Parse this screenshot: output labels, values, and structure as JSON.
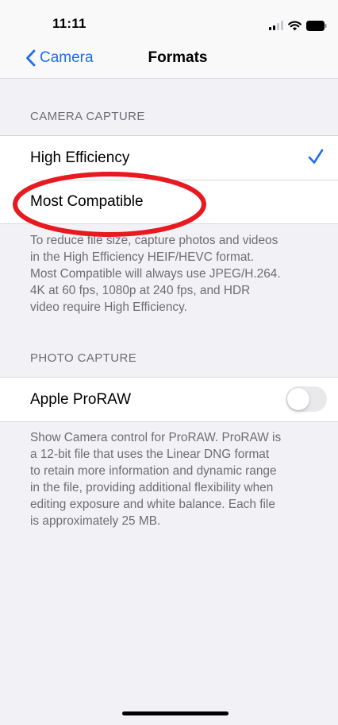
{
  "status_bar": {
    "time": "11:11",
    "icons": [
      "cellular-signal-icon",
      "wifi-icon",
      "battery-icon"
    ]
  },
  "nav": {
    "back_label": "Camera",
    "back_icon": "chevron-left-icon",
    "title": "Formats"
  },
  "camera_capture": {
    "header": "CAMERA CAPTURE",
    "options": [
      {
        "label": "High Efficiency",
        "selected": true
      },
      {
        "label": "Most Compatible",
        "selected": false
      }
    ],
    "footer_lines": [
      "To reduce file size, capture photos and videos",
      "in the High Efficiency HEIF/HEVC format.",
      "Most Compatible will always use JPEG/H.264.",
      "4K at 60 fps, 1080p at 240 fps, and HDR",
      "video require High Efficiency."
    ]
  },
  "photo_capture": {
    "header": "PHOTO CAPTURE",
    "proraw_label": "Apple ProRAW",
    "proraw_enabled": false,
    "footer_lines": [
      "Show Camera control for ProRAW. ProRAW is",
      "a 12-bit file that uses the Linear DNG format",
      "to retain more information and dynamic range",
      "in the file, providing additional flexibility when",
      "editing exposure and white balance. Each file",
      "is approximately 25 MB."
    ]
  },
  "colors": {
    "accent": "#1f6cf0",
    "annotation": "#e8191f",
    "background": "#f2f2f6",
    "secondary_text": "#6d6d72"
  }
}
